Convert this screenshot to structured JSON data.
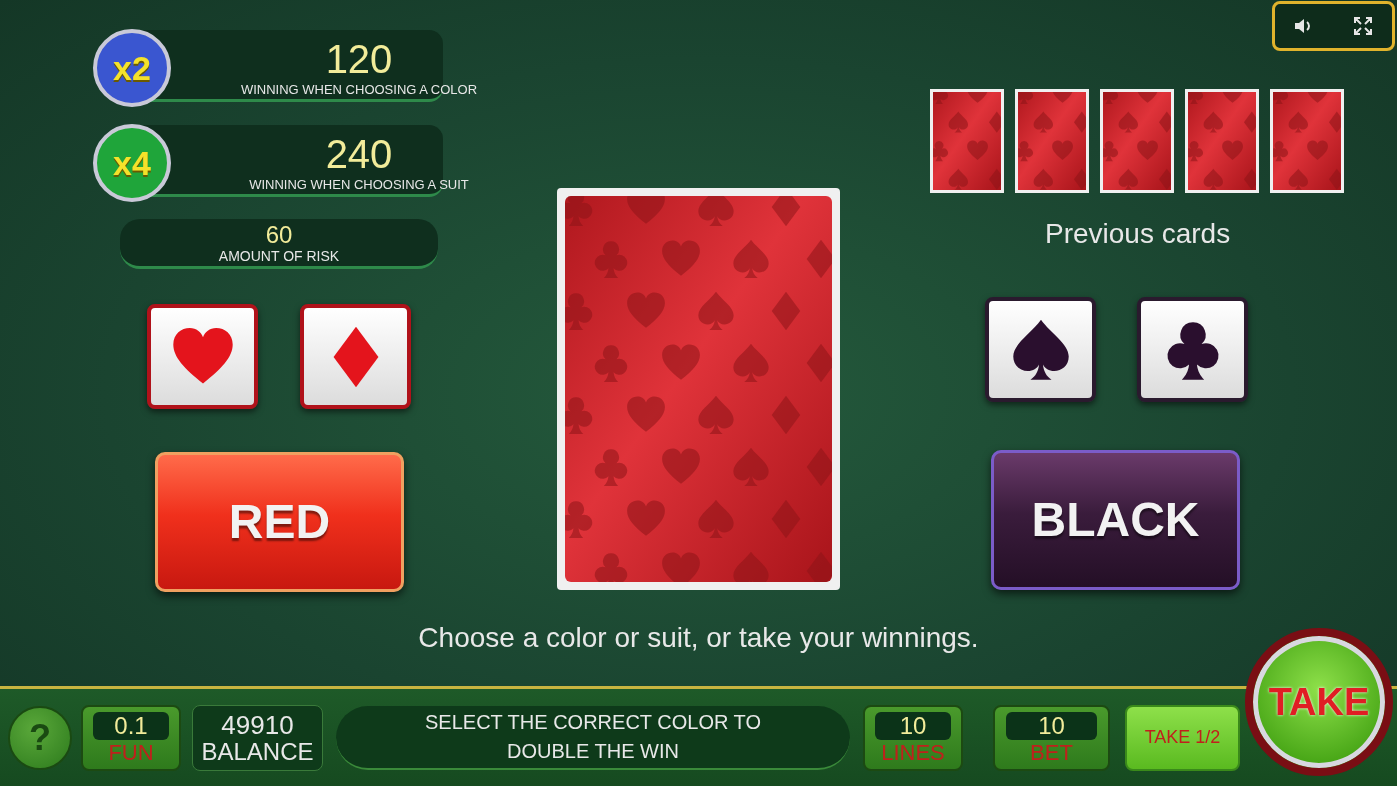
{
  "toolbar": [
    {
      "kind": "sound"
    },
    {
      "kind": "fullscreen"
    }
  ],
  "multipliers": [
    {
      "badge": "x2",
      "color": "#3a56d0",
      "value": "120",
      "label": "WINNING WHEN CHOOSING A COLOR"
    },
    {
      "badge": "x4",
      "color": "#1fa53a",
      "value": "240",
      "label": "WINNING WHEN CHOOSING A SUIT"
    }
  ],
  "risk": {
    "value": "60",
    "label": "AMOUNT OF RISK"
  },
  "red_suits": [
    {
      "kind": "heart"
    },
    {
      "kind": "diamond"
    }
  ],
  "black_suits": [
    {
      "kind": "spade"
    },
    {
      "kind": "club"
    }
  ],
  "color_buttons": [
    {
      "kind": "red",
      "label": "RED"
    },
    {
      "kind": "black",
      "label": "BLACK"
    }
  ],
  "card": {
    "face_down": true
  },
  "previous_cards": {
    "title": "Previous cards",
    "cards": [
      {
        "face_down": true
      },
      {
        "face_down": true
      },
      {
        "face_down": true
      },
      {
        "face_down": true
      },
      {
        "face_down": true
      }
    ]
  },
  "message": "Choose a color or suit, or take your winnings.",
  "bottom_bar": {
    "help": "?",
    "fun": {
      "value": "0.1",
      "label": "FUN"
    },
    "balance": {
      "value": "49910",
      "label": "BALANCE"
    },
    "status": "SELECT THE CORRECT COLOR TO DOUBLE THE WIN",
    "lines": {
      "value": "10",
      "label": "LINES"
    },
    "bet": {
      "value": "10",
      "label": "BET"
    },
    "take_half": "TAKE 1/2",
    "take": "TAKE"
  }
}
